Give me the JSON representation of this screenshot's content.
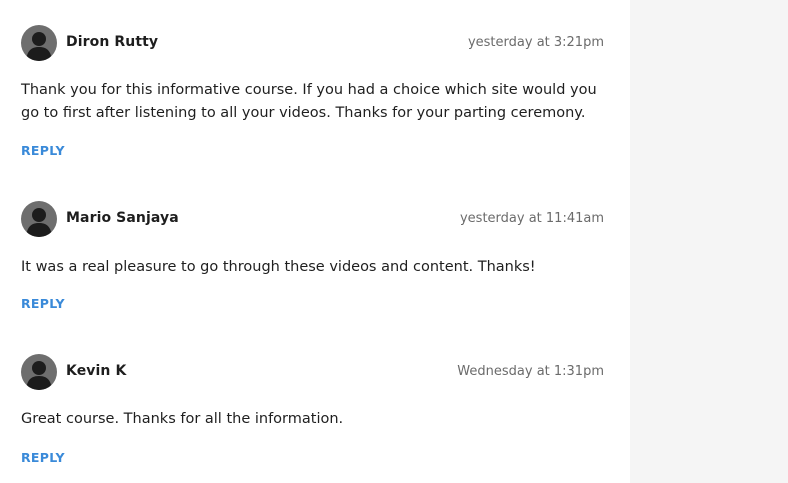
{
  "comments": [
    {
      "author": "Diron Rutty",
      "timestamp": "yesterday at 3:21pm",
      "text": "Thank you for this informative course. If you had a choice which site would you go to first after listening to all your videos. Thanks for your parting ceremony.",
      "reply_label": "REPLY",
      "avatar_icon": "user-silhouette-icon"
    },
    {
      "author": "Mario Sanjaya",
      "timestamp": "yesterday at 11:41am",
      "text": "It was a real pleasure to go through these videos and content. Thanks!",
      "reply_label": "REPLY",
      "avatar_icon": "user-silhouette-icon"
    },
    {
      "author": "Kevin K",
      "timestamp": "Wednesday at 1:31pm",
      "text": "Great course. Thanks for all the information.",
      "reply_label": "REPLY",
      "avatar_icon": "user-silhouette-icon"
    }
  ],
  "colors": {
    "accent": "#3a8ad9",
    "side_panel": "#f5f5f5",
    "avatar_bg": "#6e6e6e"
  }
}
